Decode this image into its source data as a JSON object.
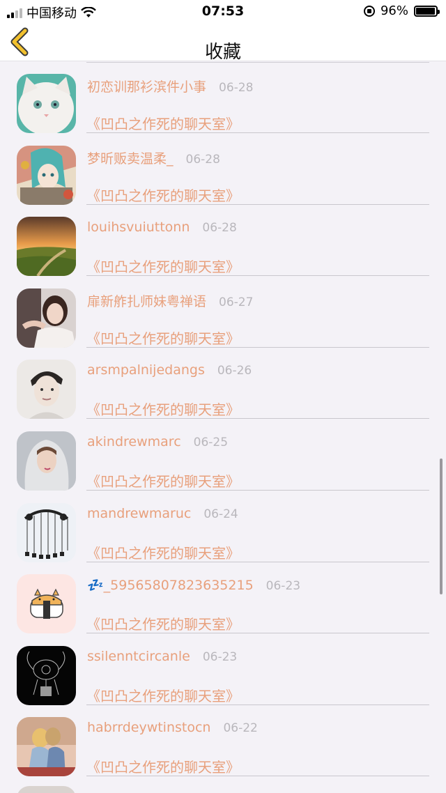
{
  "status_bar": {
    "carrier": "中国移动",
    "time": "07:53",
    "battery_percent": "96%",
    "battery_level": 0.96
  },
  "nav": {
    "title": "收藏",
    "accent_color": "#e8a07c"
  },
  "favorites": [
    {
      "name": "初恋训那衫滨件小事",
      "date": "06-28",
      "subtitle": "《凹凸之作死的聊天室》",
      "avatar": "white-cat"
    },
    {
      "name": "梦昕贩卖温柔_",
      "date": "06-28",
      "subtitle": "《凹凸之作死的聊天室》",
      "avatar": "anime-girl"
    },
    {
      "name": "louihsvuiuttonn",
      "date": "06-28",
      "subtitle": "《凹凸之作死的聊天室》",
      "avatar": "sunset-landscape"
    },
    {
      "name": "扉新舴扎师妹粤禅语",
      "date": "06-27",
      "subtitle": "《凹凸之作死的聊天室》",
      "avatar": "woman-photo"
    },
    {
      "name": "arsmpalnijedangs",
      "date": "06-26",
      "subtitle": "《凹凸之作死的聊天室》",
      "avatar": "man-sketch"
    },
    {
      "name": "akindrewmarc",
      "date": "06-25",
      "subtitle": "《凹凸之作死的聊天室》",
      "avatar": "hooded-girl"
    },
    {
      "name": "mandrewmaruc",
      "date": "06-24",
      "subtitle": "《凹凸之作死的聊天室》",
      "avatar": "wind-chime"
    },
    {
      "name": "💤_59565807823635215",
      "date": "06-23",
      "subtitle": "《凹凸之作死的聊天室》",
      "avatar": "cat-sushi"
    },
    {
      "name": "ssilenntcircanle",
      "date": "06-23",
      "subtitle": "《凹凸之作死的聊天室》",
      "avatar": "dark-art"
    },
    {
      "name": "habrrdeywtinstocn",
      "date": "06-22",
      "subtitle": "《凹凸之作死的聊天室》",
      "avatar": "couple-photo"
    }
  ]
}
